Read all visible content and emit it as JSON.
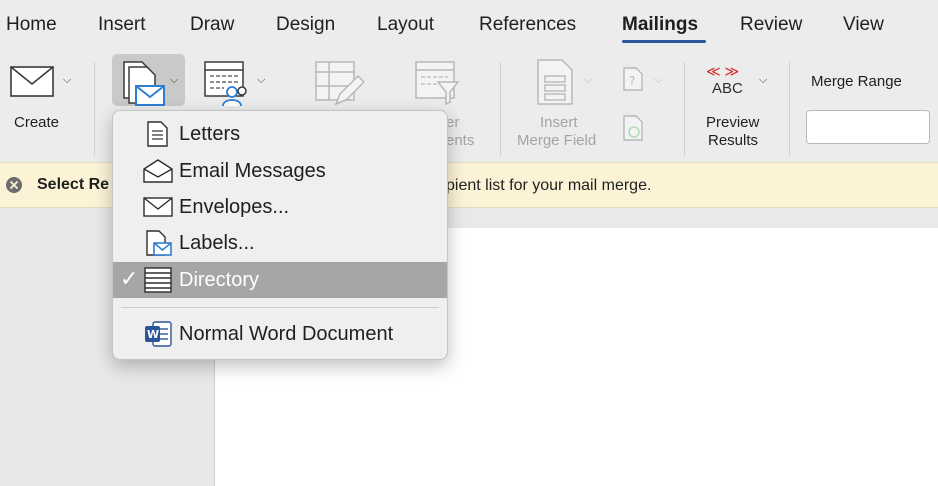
{
  "tabs": [
    {
      "label": "Home"
    },
    {
      "label": "Insert"
    },
    {
      "label": "Draw"
    },
    {
      "label": "Design"
    },
    {
      "label": "Layout"
    },
    {
      "label": "References"
    },
    {
      "label": "Mailings",
      "active": true
    },
    {
      "label": "Review"
    },
    {
      "label": "View"
    }
  ],
  "ribbon": {
    "create_label": "Create",
    "filter_label_line1": "er",
    "filter_label_line2": "ents",
    "insert_merge_field_line1": "Insert",
    "insert_merge_field_line2": "Merge Field",
    "preview_line1": "Preview",
    "preview_line2": "Results",
    "preview_icon_text": "ABC",
    "preview_icon_arrows": "≪ ≫",
    "merge_range_label": "Merge Range",
    "merge_range_value": ""
  },
  "message_bar": {
    "title": "Select Re",
    "text": "pient list for your mail merge."
  },
  "menu": {
    "items": [
      {
        "label": "Letters",
        "icon": "document-icon"
      },
      {
        "label": "Email Messages",
        "icon": "open-envelope-icon"
      },
      {
        "label": "Envelopes...",
        "icon": "envelope-icon"
      },
      {
        "label": "Labels...",
        "icon": "label-icon"
      },
      {
        "label": "Directory",
        "icon": "directory-icon",
        "selected": true
      },
      {
        "label": "Normal Word Document",
        "icon": "word-icon"
      }
    ],
    "check_glyph": "✓"
  },
  "colors": {
    "accent": "#2b579a",
    "message_bar_bg": "#fcf3d7",
    "menu_selected_bg": "#a6a6a6",
    "preview_red": "#d62b2b",
    "envelope_blue": "#2f7fd1"
  }
}
